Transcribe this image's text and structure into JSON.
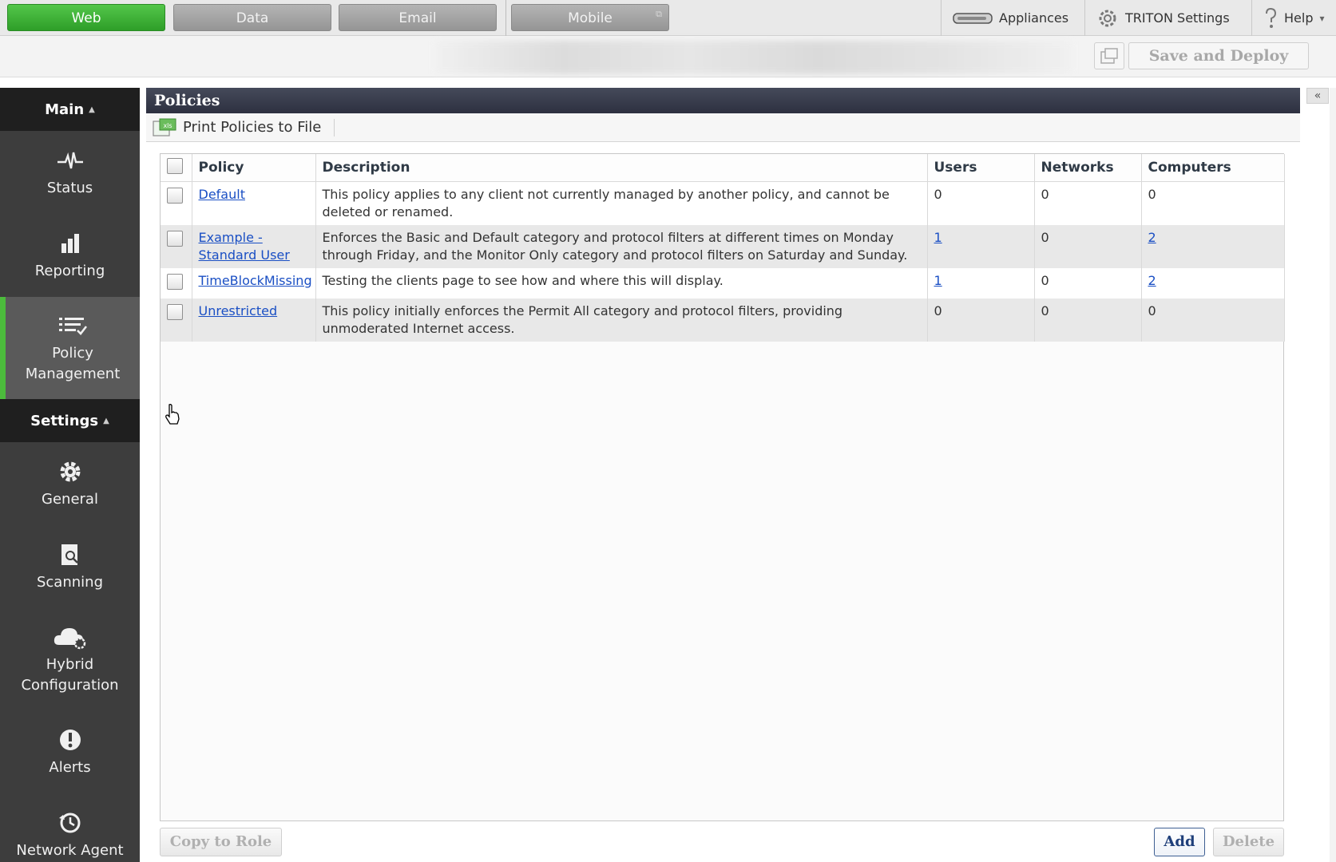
{
  "module_tabs": [
    {
      "label": "Web"
    },
    {
      "label": "Data"
    },
    {
      "label": "Email"
    },
    {
      "label": "Mobile"
    }
  ],
  "top_right": {
    "appliances_label": "Appliances",
    "triton_settings_label": "TRITON Settings",
    "help_label": "Help",
    "help_caret": "▾"
  },
  "actionbar": {
    "save_deploy_label": "Save and Deploy"
  },
  "sidebar": {
    "main_header": "Main",
    "main_items": [
      {
        "label": "Status",
        "icon": "pulse-icon"
      },
      {
        "label": "Reporting",
        "icon": "bar-chart-icon"
      },
      {
        "label": "Policy\nManagement",
        "icon": "policy-list-icon"
      }
    ],
    "settings_header": "Settings",
    "settings_items": [
      {
        "label": "General",
        "icon": "gear-icon"
      },
      {
        "label": "Scanning",
        "icon": "scan-icon"
      },
      {
        "label": "Hybrid\nConfiguration",
        "icon": "cloud-gear-icon"
      },
      {
        "label": "Alerts",
        "icon": "alert-icon"
      },
      {
        "label": "Network Agent",
        "icon": "history-icon"
      }
    ],
    "caret": "▲"
  },
  "panel": {
    "title": "Policies",
    "print_label": "Print Policies to File",
    "collapse_label": "«"
  },
  "table": {
    "headers": [
      "Policy",
      "Description",
      "Users",
      "Networks",
      "Computers"
    ],
    "rows": [
      {
        "policy": "Default",
        "description": "This policy applies to any client not currently managed by another policy, and cannot be deleted or renamed.",
        "users": "0",
        "users_link": false,
        "networks": "0",
        "computers": "0",
        "computers_link": false
      },
      {
        "policy": "Example - Standard User",
        "description": "Enforces the Basic and Default category and protocol filters at different times on Monday through Friday, and the Monitor Only category and protocol filters on Saturday and Sunday.",
        "users": "1",
        "users_link": true,
        "networks": "0",
        "computers": "2",
        "computers_link": true
      },
      {
        "policy": "TimeBlockMissing",
        "description": "Testing the clients page to see how and where this will display.",
        "users": "1",
        "users_link": true,
        "networks": "0",
        "computers": "2",
        "computers_link": true
      },
      {
        "policy": "Unrestricted",
        "description": "This policy initially enforces the Permit All category and protocol filters, providing unmoderated Internet access.",
        "users": "0",
        "users_link": false,
        "networks": "0",
        "computers": "0",
        "computers_link": false
      }
    ]
  },
  "buttons": {
    "copy_to_role": "Copy to Role",
    "add": "Add",
    "delete": "Delete"
  },
  "colors": {
    "active_tab": "#3aad33",
    "sidebar_bg": "#3d3d3d",
    "accent_green": "#4cbb3c",
    "link_blue": "#1a4fc4",
    "title_bar": "#2d3040"
  }
}
